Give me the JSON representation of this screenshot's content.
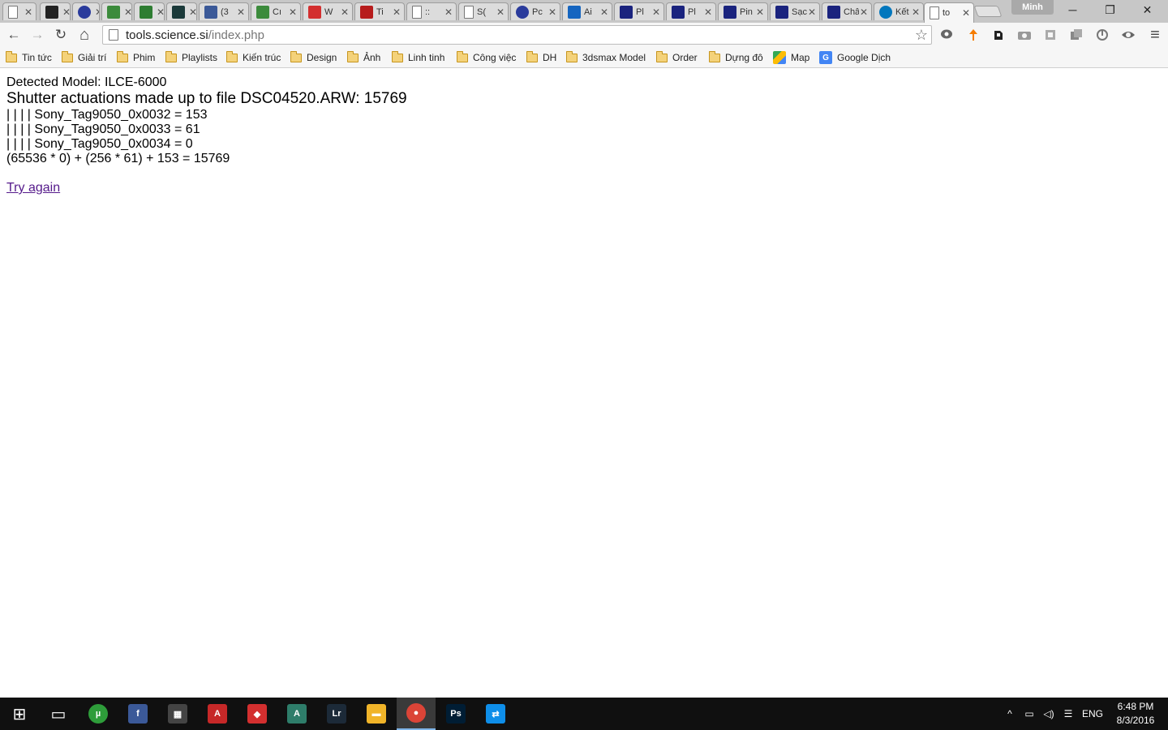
{
  "window": {
    "profile_name": "Minh",
    "minimize_glyph": "─",
    "restore_glyph": "❐",
    "close_glyph": "✕"
  },
  "tabs": [
    {
      "title": "",
      "icon": "page-icon",
      "color": "#ffffff"
    },
    {
      "title": "",
      "icon": "medium-logo-icon",
      "color": "#222222"
    },
    {
      "title": "",
      "icon": "s-circle-icon",
      "color": "#2a3b9c"
    },
    {
      "title": "",
      "icon": "leaf-icon",
      "color": "#3c8b3c"
    },
    {
      "title": "",
      "icon": "tree-icon",
      "color": "#2e7d32"
    },
    {
      "title": "",
      "icon": "dark-square-icon",
      "color": "#1b3a3a"
    },
    {
      "title": "(3",
      "icon": "facebook-icon",
      "color": "#3b5998"
    },
    {
      "title": "Cı",
      "icon": "leaf-icon",
      "color": "#3c8b3c"
    },
    {
      "title": "W",
      "icon": "v-logo-icon",
      "color": "#d32f2f"
    },
    {
      "title": "Ti",
      "icon": "e-logo-icon",
      "color": "#b71c1c"
    },
    {
      "title": "::",
      "icon": "page-icon",
      "color": "#ffffff"
    },
    {
      "title": "S(",
      "icon": "page-icon",
      "color": "#ffffff"
    },
    {
      "title": "Pc",
      "icon": "s-circle-icon",
      "color": "#2a3b9c"
    },
    {
      "title": "Ai",
      "icon": "shield-icon",
      "color": "#1565c0"
    },
    {
      "title": "Pl",
      "icon": "flag-icon",
      "color": "#1a237e"
    },
    {
      "title": "Pl",
      "icon": "flag-icon",
      "color": "#1a237e"
    },
    {
      "title": "Pin S.",
      "icon": "flag-icon",
      "color": "#1a237e"
    },
    {
      "title": "Sạc P",
      "icon": "flag-icon",
      "color": "#1a237e"
    },
    {
      "title": "Chân",
      "icon": "flag-icon",
      "color": "#1a237e"
    },
    {
      "title": "Kết q",
      "icon": "globe-icon",
      "color": "#0277bd"
    },
    {
      "title": "to",
      "icon": "page-icon",
      "color": "#ffffff",
      "active": true
    }
  ],
  "toolbar": {
    "back_glyph": "←",
    "forward_glyph": "→",
    "reload_glyph": "↻",
    "home_glyph": "⌂",
    "url_host": "tools.science.si",
    "url_path": "/index.php",
    "star_glyph": "☆",
    "menu_glyph": "≡"
  },
  "bookmarks": [
    {
      "label": "Tin tức",
      "type": "folder"
    },
    {
      "label": "Giải trí",
      "type": "folder"
    },
    {
      "label": "Phim",
      "type": "folder"
    },
    {
      "label": "Playlists",
      "type": "folder"
    },
    {
      "label": "Kiến trúc",
      "type": "folder"
    },
    {
      "label": "Design",
      "type": "folder"
    },
    {
      "label": "Ảnh",
      "type": "folder"
    },
    {
      "label": "Linh tinh",
      "type": "folder"
    },
    {
      "label": "Công việc",
      "type": "folder"
    },
    {
      "label": "DH",
      "type": "folder"
    },
    {
      "label": "3dsmax Model",
      "type": "folder"
    },
    {
      "label": "Order",
      "type": "folder"
    },
    {
      "label": "Dựng đô",
      "type": "folder"
    },
    {
      "label": "Map",
      "type": "maps-icon"
    },
    {
      "label": "Google Dịch",
      "type": "translate-icon"
    }
  ],
  "page": {
    "detected_model": "Detected Model: ILCE-6000",
    "headline": "Shutter actuations made up to file DSC04520.ARW: 15769",
    "tag_lines": [
      "| | | | Sony_Tag9050_0x0032 = 153",
      "| | | | Sony_Tag9050_0x0033 = 61",
      "| | | | Sony_Tag9050_0x0034 = 0"
    ],
    "formula": "(65536 * 0) + (256 * 61) + 153 = 15769",
    "try_again": "Try again"
  },
  "taskbar": {
    "apps": [
      {
        "name": "start",
        "label": "⊞",
        "color": "#101010"
      },
      {
        "name": "task-view",
        "label": "▭",
        "color": "#101010"
      },
      {
        "name": "utorrent",
        "label": "µ",
        "color": "#2e9d3a"
      },
      {
        "name": "facebook",
        "label": "f",
        "color": "#3b5998"
      },
      {
        "name": "calculator",
        "label": "▦",
        "color": "#444444"
      },
      {
        "name": "autocad",
        "label": "A",
        "color": "#c62828"
      },
      {
        "name": "sketchup",
        "label": "◆",
        "color": "#d32f2f"
      },
      {
        "name": "maps-app",
        "label": "A",
        "color": "#2e7d6a"
      },
      {
        "name": "lightroom",
        "label": "Lr",
        "color": "#1c2a38"
      },
      {
        "name": "file-explorer",
        "label": "▬",
        "color": "#f0b429"
      },
      {
        "name": "chrome",
        "label": "●",
        "color": "#db4437",
        "active": true
      },
      {
        "name": "photoshop",
        "label": "Ps",
        "color": "#001d34"
      },
      {
        "name": "teamviewer",
        "label": "⇄",
        "color": "#0e8ee9"
      }
    ],
    "language": "ENG",
    "time": "6:48 PM",
    "date": "8/3/2016",
    "tray_up_glyph": "^",
    "tray_network_glyph": "▭",
    "tray_volume_glyph": "◁)",
    "tray_notify_glyph": "☰"
  }
}
